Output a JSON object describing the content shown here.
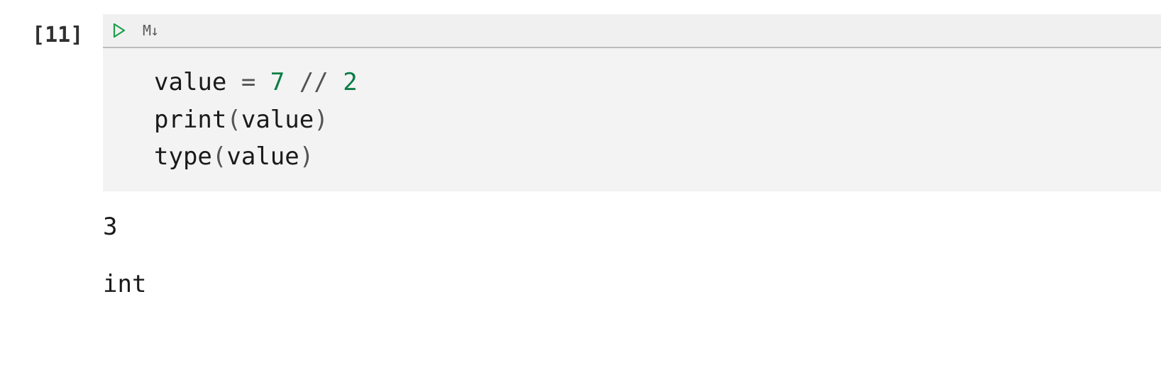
{
  "cell": {
    "prompt_open": "[",
    "prompt_number": "11",
    "prompt_close": "]",
    "toolbar": {
      "run_icon": "play",
      "markdown_label": "M↓"
    },
    "code": {
      "l1_p1": "value ",
      "l1_op1": "=",
      "l1_sp1": " ",
      "l1_n1": "7",
      "l1_sp2": " ",
      "l1_op2": "//",
      "l1_sp3": " ",
      "l1_n2": "2",
      "l2_p1": "print",
      "l2_op1": "(",
      "l2_p2": "value",
      "l2_op2": ")",
      "l3_p1": "type",
      "l3_op1": "(",
      "l3_p2": "value",
      "l3_op2": ")"
    },
    "output": {
      "line1": "3",
      "line2": "int"
    }
  }
}
